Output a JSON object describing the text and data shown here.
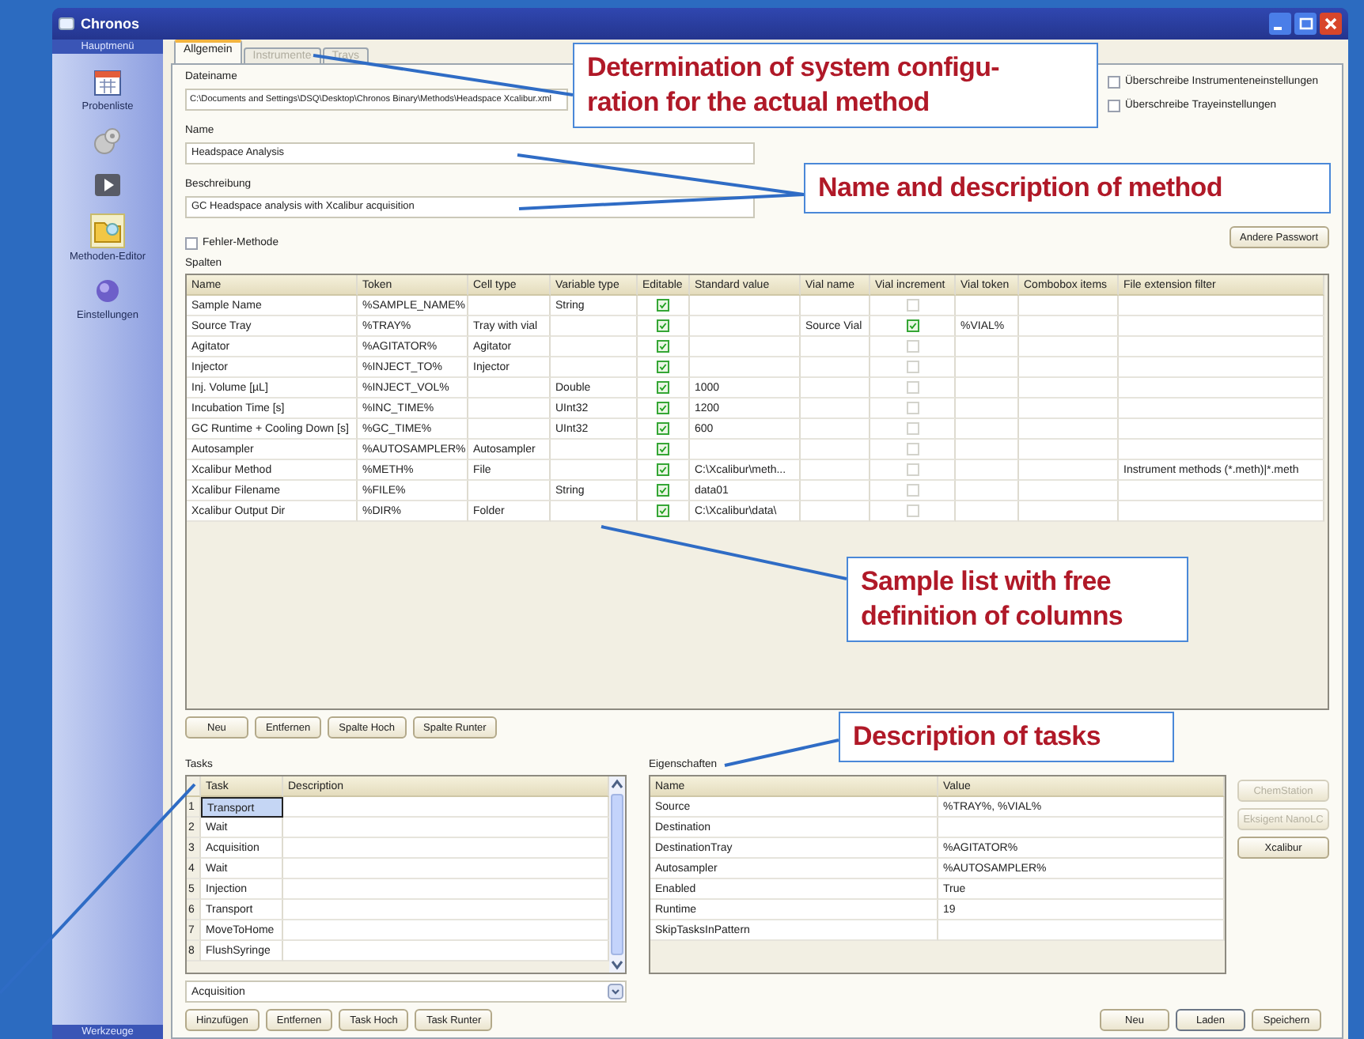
{
  "window": {
    "title": "Chronos"
  },
  "sidebar": {
    "header": "Hauptmenü",
    "footer": "Werkzeuge",
    "items": [
      {
        "kind": "calendar",
        "label": "Probenliste",
        "selected": false
      },
      {
        "kind": "gear",
        "selected": false
      },
      {
        "kind": "play",
        "selected": false
      },
      {
        "kind": "folder",
        "label": "Methoden-Editor",
        "selected": true
      },
      {
        "kind": "sphere",
        "label": "Einstellungen",
        "selected": false
      }
    ]
  },
  "tabs": [
    {
      "label": "Allgemein",
      "selected": true,
      "disabled": false
    },
    {
      "label": "Instrumente",
      "selected": false,
      "disabled": true
    },
    {
      "label": "Trays",
      "selected": false,
      "disabled": true
    }
  ],
  "fields": [
    {
      "label": "Dateiname",
      "value": "C:\\Documents and Settings\\DSQ\\Desktop\\Chronos Binary\\Methods\\Headspace Xcalibur.xml"
    },
    {
      "label": "Name",
      "value": "Headspace Analysis"
    },
    {
      "label": "Beschreibung",
      "value": "GC Headspace analysis with Xcalibur acquisition"
    }
  ],
  "options": [
    {
      "label": "Überschreibe Instrumenteneinstellungen",
      "checked": false
    },
    {
      "label": "Überschreibe Trayeinstellungen",
      "checked": false
    }
  ],
  "error_method": {
    "label": "Fehler-Methode",
    "checked": false
  },
  "password_button": "Andere Passwort",
  "columns_table": {
    "label": "Spalten",
    "columns": [
      "Name",
      "Token",
      "Cell type",
      "Variable type",
      "Editable",
      "Standard value",
      "Vial name",
      "Vial increment",
      "Vial token",
      "Combobox items",
      "File extension filter"
    ],
    "rows": [
      {
        "name": "Sample Name",
        "token": "%SAMPLE_NAME%",
        "variable_type": "String",
        "editable": true,
        "vial_increment": false
      },
      {
        "name": "Source Tray",
        "token": "%TRAY%",
        "cell_type": "Tray with vial",
        "editable": true,
        "vial_name": "Source Vial",
        "vial_increment": true,
        "vial_token": "%VIAL%"
      },
      {
        "name": "Agitator",
        "token": "%AGITATOR%",
        "cell_type": "Agitator",
        "editable": true,
        "vial_increment": false
      },
      {
        "name": "Injector",
        "token": "%INJECT_TO%",
        "cell_type": "Injector",
        "editable": true,
        "vial_increment": false
      },
      {
        "name": "Inj. Volume [µL]",
        "token": "%INJECT_VOL%",
        "variable_type": "Double",
        "editable": true,
        "standard_value": "1000",
        "vial_increment": false
      },
      {
        "name": "Incubation Time [s]",
        "token": "%INC_TIME%",
        "variable_type": "UInt32",
        "editable": true,
        "standard_value": "1200",
        "vial_increment": false
      },
      {
        "name": "GC Runtime + Cooling Down [s]",
        "token": "%GC_TIME%",
        "variable_type": "UInt32",
        "editable": true,
        "standard_value": "600",
        "vial_increment": false
      },
      {
        "name": "Autosampler",
        "token": "%AUTOSAMPLER%",
        "cell_type": "Autosampler",
        "editable": true,
        "vial_increment": false
      },
      {
        "name": "Xcalibur Method",
        "token": "%METH%",
        "cell_type": "File",
        "editable": true,
        "standard_value": "C:\\Xcalibur\\meth...",
        "vial_increment": false,
        "file_extension_filter": "Instrument methods (*.meth)|*.meth"
      },
      {
        "name": "Xcalibur Filename",
        "token": "%FILE%",
        "variable_type": "String",
        "editable": true,
        "standard_value": "data01",
        "vial_increment": false
      },
      {
        "name": "Xcalibur Output Dir",
        "token": "%DIR%",
        "cell_type": "Folder",
        "editable": true,
        "standard_value": "C:\\Xcalibur\\data\\",
        "vial_increment": false
      }
    ]
  },
  "columns_buttons": [
    "Neu",
    "Entfernen",
    "Spalte Hoch",
    "Spalte Runter"
  ],
  "tasks": {
    "label": "Tasks",
    "columns": [
      "Task",
      "Description"
    ],
    "rows": [
      {
        "number": "1",
        "task": "Transport",
        "selected": true
      },
      {
        "number": "2",
        "task": "Wait",
        "selected": false
      },
      {
        "number": "3",
        "task": "Acquisition",
        "selected": false
      },
      {
        "number": "4",
        "task": "Wait",
        "selected": false
      },
      {
        "number": "5",
        "task": "Injection",
        "selected": false
      },
      {
        "number": "6",
        "task": "Transport",
        "selected": false
      },
      {
        "number": "7",
        "task": "MoveToHome",
        "selected": false
      },
      {
        "number": "8",
        "task": "FlushSyringe",
        "selected": false
      }
    ],
    "combo": "Acquisition"
  },
  "tasks_buttons": [
    "Hinzufügen",
    "Entfernen",
    "Task Hoch",
    "Task Runter"
  ],
  "properties": {
    "label": "Eigenschaften",
    "columns": [
      "Name",
      "Value"
    ],
    "rows": [
      {
        "name": "Source",
        "value": "%TRAY%, %VIAL%"
      },
      {
        "name": "Destination"
      },
      {
        "name": "DestinationTray",
        "value": "%AGITATOR%"
      },
      {
        "name": "Autosampler",
        "value": "%AUTOSAMPLER%"
      },
      {
        "name": "Enabled",
        "value": "True"
      },
      {
        "name": "Runtime",
        "value": "19"
      },
      {
        "name": "SkipTasksInPattern"
      }
    ]
  },
  "instrument_buttons": [
    {
      "label": "ChemStation",
      "disabled": true
    },
    {
      "label": "Eksigent NanoLC",
      "disabled": true
    },
    {
      "label": "Xcalibur",
      "disabled": false
    }
  ],
  "footer_buttons": [
    "Neu",
    "Laden",
    "Speichern"
  ],
  "callouts": [
    {
      "lines": [
        "Determination of system configu-",
        "ration for the actual method"
      ]
    },
    {
      "lines": [
        "Name and description of method"
      ]
    },
    {
      "lines": [
        "Sample list with free",
        "definition of columns"
      ]
    },
    {
      "lines": [
        "Description of tasks"
      ]
    }
  ]
}
